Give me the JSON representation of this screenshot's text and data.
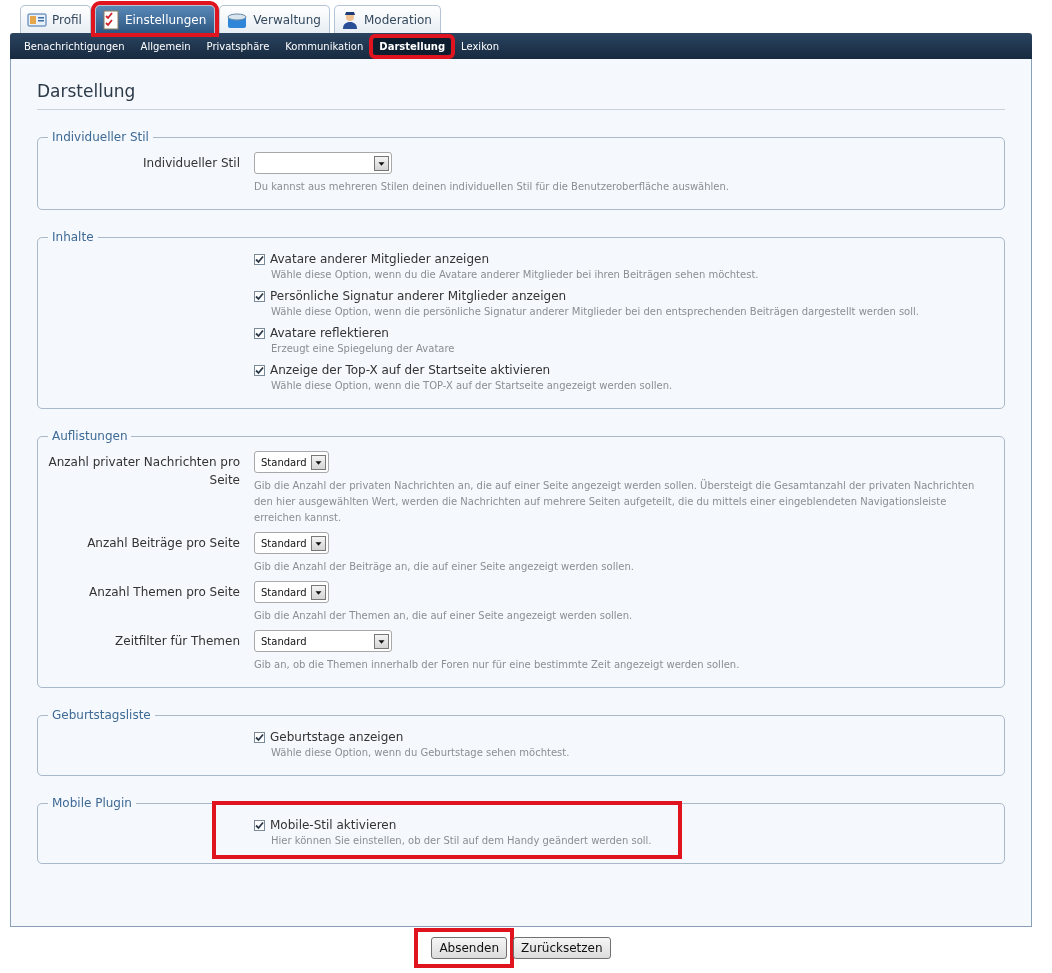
{
  "tabs": [
    {
      "label": "Profil",
      "selected": false,
      "highlighted": false
    },
    {
      "label": "Einstellungen",
      "selected": true,
      "highlighted": true
    },
    {
      "label": "Verwaltung",
      "selected": false,
      "highlighted": false
    },
    {
      "label": "Moderation",
      "selected": false,
      "highlighted": false
    }
  ],
  "subtabs": [
    {
      "label": "Benachrichtigungen",
      "selected": false,
      "highlighted": false
    },
    {
      "label": "Allgemein",
      "selected": false,
      "highlighted": false
    },
    {
      "label": "Privatsphäre",
      "selected": false,
      "highlighted": false
    },
    {
      "label": "Kommunikation",
      "selected": false,
      "highlighted": false
    },
    {
      "label": "Darstellung",
      "selected": true,
      "highlighted": true
    },
    {
      "label": "Lexikon",
      "selected": false,
      "highlighted": false
    }
  ],
  "heading": "Darstellung",
  "sections": [
    {
      "legend": "Individueller Stil",
      "rows": [
        {
          "kind": "select",
          "label": "Individueller Stil",
          "wide": true,
          "description": "Du kannst aus mehreren Stilen deinen individuellen Stil für die Benutzeroberfläche auswählen."
        }
      ]
    },
    {
      "legend": "Inhalte",
      "rows": [
        {
          "kind": "checkbox",
          "label": "Avatare anderer Mitglieder anzeigen",
          "checked": true,
          "highlighted": false,
          "description": "Wähle diese Option, wenn du die Avatare anderer Mitglieder bei ihren Beiträgen sehen möchtest."
        },
        {
          "kind": "checkbox",
          "label": "Persönliche Signatur anderer Mitglieder anzeigen",
          "checked": true,
          "highlighted": false,
          "description": "Wähle diese Option, wenn die persönliche Signatur anderer Mitglieder bei den entsprechenden Beiträgen dargestellt werden soll."
        },
        {
          "kind": "checkbox",
          "label": "Avatare reflektieren",
          "checked": true,
          "highlighted": false,
          "description": "Erzeugt eine Spiegelung der Avatare"
        },
        {
          "kind": "checkbox",
          "label": "Anzeige der Top-X auf der Startseite aktivieren",
          "checked": true,
          "highlighted": false,
          "description": "Wähle diese Option, wenn die TOP-X auf der Startseite angezeigt werden sollen."
        }
      ]
    },
    {
      "legend": "Auflistungen",
      "rows": [
        {
          "kind": "select",
          "label": "Anzahl privater Nachrichten pro Seite",
          "value": "Standard",
          "wide": false,
          "description": "Gib die Anzahl der privaten Nachrichten an, die auf einer Seite angezeigt werden sollen. Übersteigt die Gesamtanzahl der privaten Nachrichten den hier ausgewählten Wert, werden die Nachrichten auf mehrere Seiten aufgeteilt, die du mittels einer eingeblendeten Navigationsleiste erreichen kannst."
        },
        {
          "kind": "select",
          "label": "Anzahl Beiträge pro Seite",
          "value": "Standard",
          "wide": false,
          "description": "Gib die Anzahl der Beiträge an, die auf einer Seite angezeigt werden sollen."
        },
        {
          "kind": "select",
          "label": "Anzahl Themen pro Seite",
          "value": "Standard",
          "wide": false,
          "description": "Gib die Anzahl der Themen an, die auf einer Seite angezeigt werden sollen."
        },
        {
          "kind": "select",
          "label": "Zeitfilter für Themen",
          "value": "Standard",
          "wide": true,
          "description": "Gib an, ob die Themen innerhalb der Foren nur für eine bestimmte Zeit angezeigt werden sollen."
        }
      ]
    },
    {
      "legend": "Geburtstagsliste",
      "rows": [
        {
          "kind": "checkbox",
          "label": "Geburtstage anzeigen",
          "checked": true,
          "highlighted": false,
          "description": "Wähle diese Option, wenn du Geburtstage sehen möchtest."
        }
      ]
    },
    {
      "legend": "Mobile Plugin",
      "rows": [
        {
          "kind": "checkbox",
          "label": "Mobile-Stil aktivieren",
          "checked": true,
          "highlighted": true,
          "description": "Hier können Sie einstellen, ob der Stil auf dem Handy geändert werden soll."
        }
      ]
    }
  ],
  "buttons": [
    {
      "label": "Absenden",
      "highlighted": true
    },
    {
      "label": "Zurücksetzen",
      "highlighted": false
    }
  ]
}
